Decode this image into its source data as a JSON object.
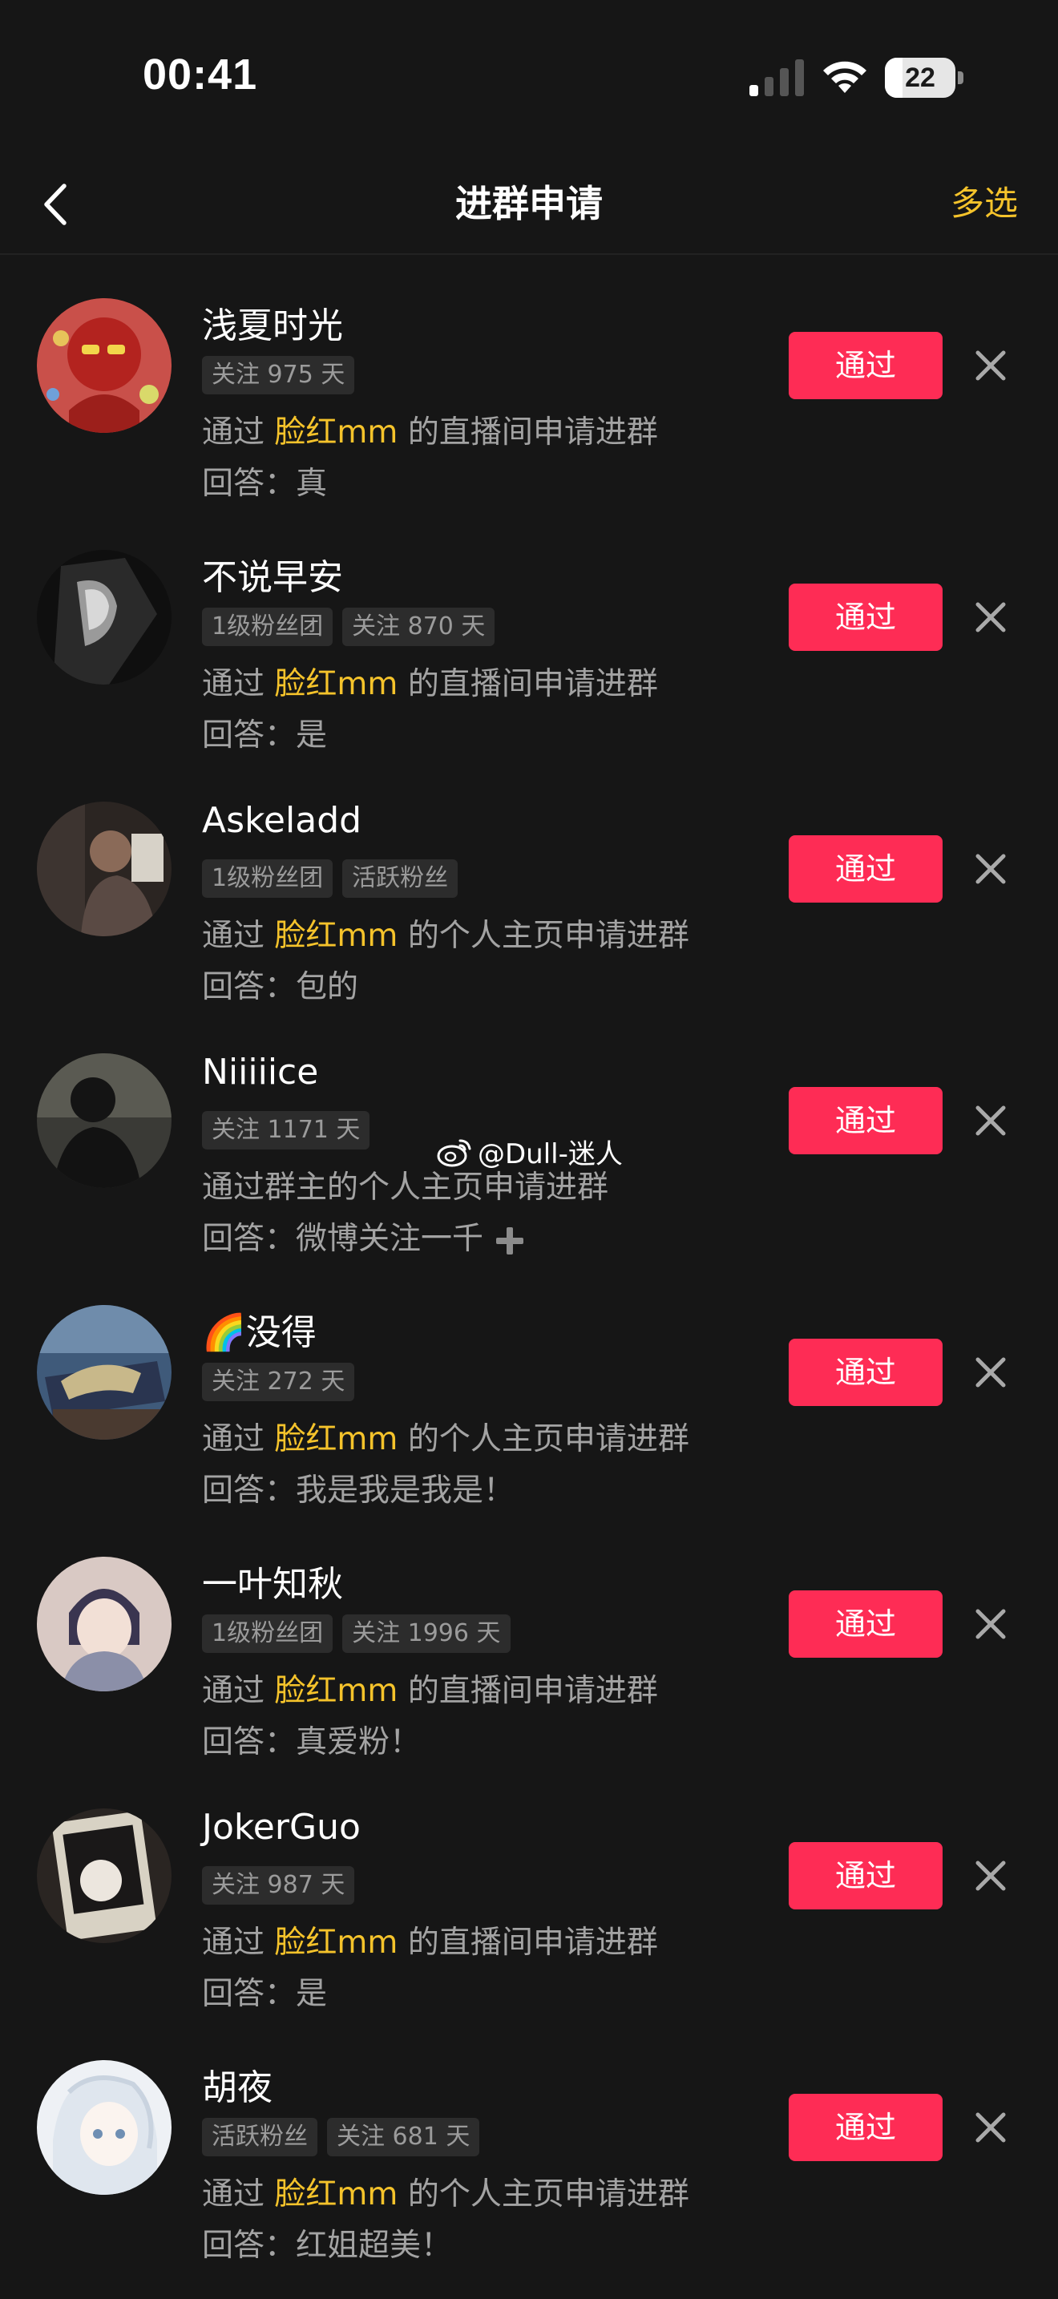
{
  "status_bar": {
    "time": "00:41",
    "battery": "22"
  },
  "nav": {
    "title": "进群申请",
    "multi_select": "多选"
  },
  "watermark": "@Dull-迷人",
  "labels": {
    "approve": "通过",
    "answer_prefix": "回答："
  },
  "requests": [
    {
      "name": "浅夏时光",
      "tags": [
        "关注 975 天"
      ],
      "via_before": "通过",
      "host": "脸红mm",
      "via_after": "的直播间申请进群",
      "answer": "真"
    },
    {
      "name": "不说早安",
      "tags": [
        "1级粉丝团",
        "关注 870 天"
      ],
      "via_before": "通过",
      "host": "脸红mm",
      "via_after": "的直播间申请进群",
      "answer": "是"
    },
    {
      "name": "Askeladd",
      "tags": [
        "1级粉丝团",
        "活跃粉丝"
      ],
      "via_before": "通过",
      "host": "脸红mm",
      "via_after": "的个人主页申请进群",
      "answer": "包的"
    },
    {
      "name": "Niiiiice",
      "tags": [
        "关注 1171 天"
      ],
      "via_before": "通过群主的个人主页申请进群",
      "host": "",
      "via_after": "",
      "answer": "微博关注一千"
    },
    {
      "name": "🌈没得",
      "tags": [
        "关注 272 天"
      ],
      "via_before": "通过",
      "host": "脸红mm",
      "via_after": "的个人主页申请进群",
      "answer": "我是我是我是！"
    },
    {
      "name": "一叶知秋",
      "tags": [
        "1级粉丝团",
        "关注 1996 天"
      ],
      "via_before": "通过",
      "host": "脸红mm",
      "via_after": "的直播间申请进群",
      "answer": "真爱粉！"
    },
    {
      "name": "JokerGuo",
      "tags": [
        "关注 987 天"
      ],
      "via_before": "通过",
      "host": "脸红mm",
      "via_after": "的直播间申请进群",
      "answer": "是"
    },
    {
      "name": "胡夜",
      "tags": [
        "活跃粉丝",
        "关注 681 天"
      ],
      "via_before": "通过",
      "host": "脸红mm",
      "via_after": "的个人主页申请进群",
      "answer": "红姐超美！"
    }
  ],
  "colors": {
    "accent": "#fe2c55",
    "highlight": "#f5c32b",
    "background": "#161616"
  },
  "icons": [
    "back-chevron-icon",
    "close-icon",
    "plus-icon",
    "weibo-icon",
    "signal-icon",
    "wifi-icon",
    "battery-icon"
  ]
}
